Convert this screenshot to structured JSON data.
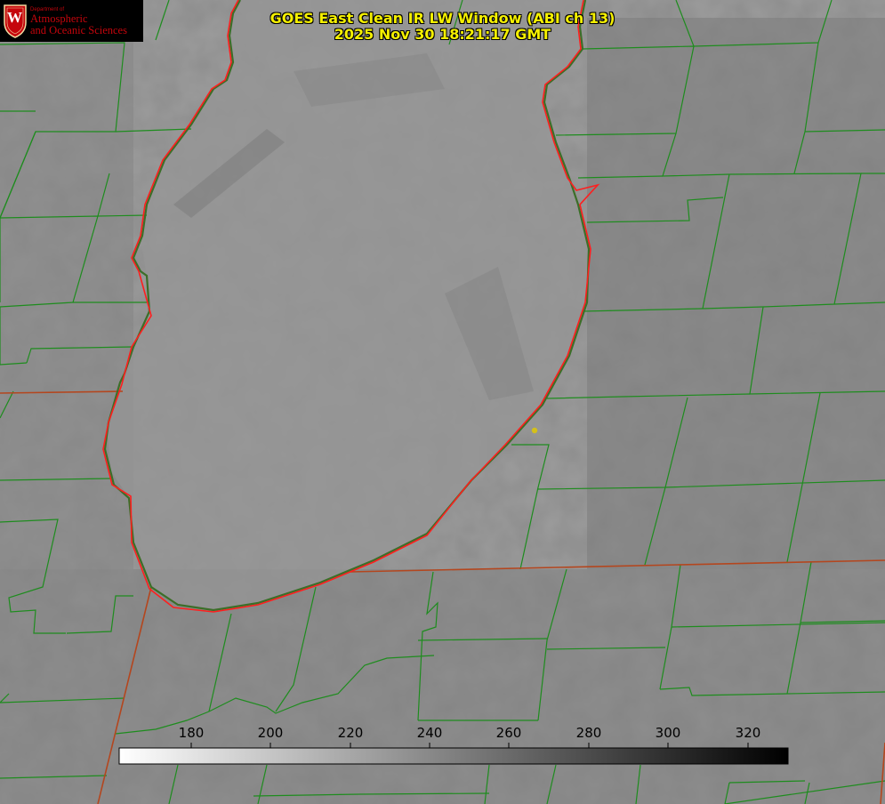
{
  "title": {
    "line1": "GOES East Clean IR LW Window (ABI ch 13)",
    "line2": "2025 Nov 30 18:21:17 GMT"
  },
  "logo": {
    "department": "Department of",
    "line1": "Atmospheric",
    "line2": "and Oceanic Sciences",
    "seal_letter": "W"
  },
  "colorbar": {
    "ticks": [
      "180",
      "200",
      "220",
      "240",
      "260",
      "280",
      "300",
      "320"
    ],
    "gradient_from": "#ffffff",
    "gradient_to": "#000000"
  },
  "colors": {
    "county_lines": "#1e8c1e",
    "state_border": "#b4461e",
    "lake_outline": "#ff1e1e",
    "title_text": "#f5f000",
    "marker": "#d4c01a",
    "logo_red": "#c5050c"
  },
  "marker_icon": "location-dot-icon"
}
